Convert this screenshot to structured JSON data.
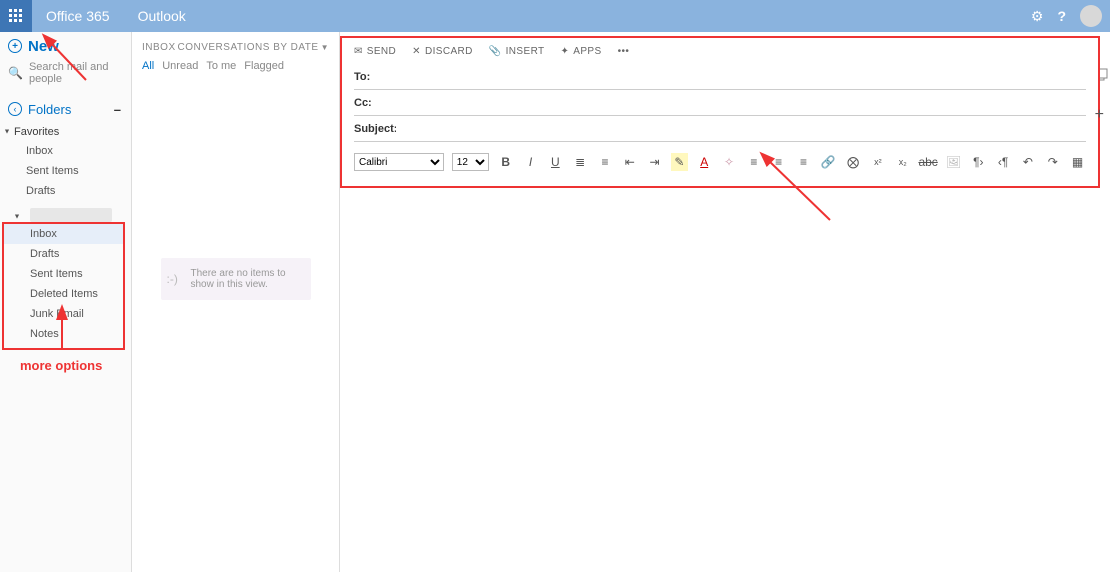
{
  "header": {
    "brand": "Office 365",
    "app": "Outlook"
  },
  "sidebar": {
    "new_label": "New",
    "search_placeholder": "Search mail and people",
    "folders_label": "Folders",
    "favorites_label": "Favorites",
    "favorites": [
      "Inbox",
      "Sent Items",
      "Drafts"
    ],
    "account_folders": [
      "Inbox",
      "Drafts",
      "Sent Items",
      "Deleted Items",
      "Junk Email",
      "Notes"
    ],
    "annotation": "more options"
  },
  "mlist": {
    "title": "INBOX",
    "sort_label": "CONVERSATIONS BY DATE",
    "filters": [
      "All",
      "Unread",
      "To me",
      "Flagged"
    ],
    "empty_text": "There are no items to show in this view."
  },
  "compose": {
    "actions": {
      "send": "SEND",
      "discard": "DISCARD",
      "insert": "INSERT",
      "apps": "APPS"
    },
    "fields": {
      "to": "To:",
      "cc": "Cc:",
      "subject": "Subject:"
    },
    "font_name": "Calibri",
    "font_size": "12"
  }
}
